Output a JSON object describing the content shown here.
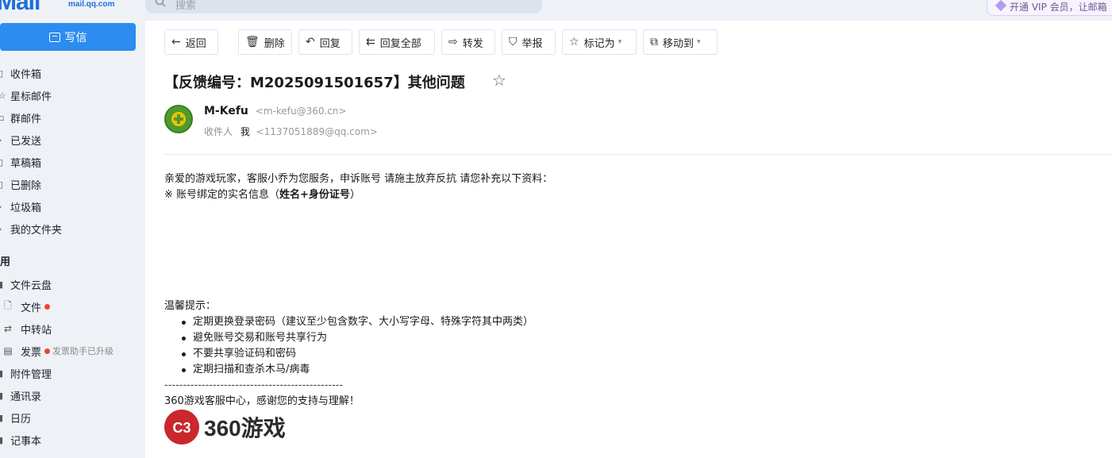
{
  "app": {
    "logo_text": "Mail",
    "logo_sub": "mail.qq.com",
    "search_placeholder": "搜索",
    "vip_text": "开通 VIP 会员，让邮箱"
  },
  "sidebar": {
    "compose_label": "写信",
    "items": [
      {
        "label": "收件箱",
        "icon": "inbox-icon"
      },
      {
        "label": "星标邮件",
        "icon": "star-icon"
      },
      {
        "label": "群邮件",
        "icon": "group-mail-icon"
      },
      {
        "label": "已发送",
        "icon": "sent-icon"
      },
      {
        "label": "草稿箱",
        "icon": "draft-icon"
      },
      {
        "label": "已删除",
        "icon": "trash-icon"
      },
      {
        "label": "垃圾箱",
        "icon": "spam-icon"
      },
      {
        "label": "我的文件夹",
        "icon": "folder-icon"
      }
    ],
    "section_label": "用",
    "apps": [
      {
        "label": "文件云盘",
        "icon": "cloud-icon"
      },
      {
        "label": "文件",
        "icon": "file-icon",
        "dot": true
      },
      {
        "label": "中转站",
        "icon": "transfer-icon"
      },
      {
        "label": "发票",
        "icon": "invoice-icon",
        "dot": true,
        "note": "发票助手已升级"
      },
      {
        "label": "附件管理",
        "icon": "attachment-icon"
      },
      {
        "label": "通讯录",
        "icon": "contacts-icon"
      },
      {
        "label": "日历",
        "icon": "calendar-icon"
      },
      {
        "label": "记事本",
        "icon": "notebook-icon"
      }
    ]
  },
  "toolbar": {
    "back": "返回",
    "delete": "删除",
    "reply": "回复",
    "reply_all": "回复全部",
    "forward": "转发",
    "report": "举报",
    "mark_as": "标记为",
    "move_to": "移动到"
  },
  "email": {
    "subject": "【反馈编号：M2025091501657】其他问题",
    "sender_name": "M-Kefu",
    "sender_addr": "<m-kefu@360.cn>",
    "recipient_label": "收件人",
    "recipient_name": "我",
    "recipient_addr": "<1137051889@qq.com>",
    "line1": "亲爱的游戏玩家，客服小乔为您服务，申诉账号 请施主放弃反抗 请您补充以下资料：",
    "line2_prefix": "※ 账号绑定的实名信息（",
    "line2_bold": "姓名+身份证号",
    "line2_suffix": "）",
    "tips_title": "温馨提示：",
    "tips": [
      "定期更换登录密码（建议至少包含数字、大小写字母、特殊字符其中两类）",
      "避免账号交易和账号共享行为",
      "不要共享验证码和密码",
      "定期扫描和查杀木马/病毒"
    ],
    "separator": "------------------------------------------------",
    "closing": "360游戏客服中心，感谢您的支持与理解！",
    "brand_logo_text": "C3",
    "brand_text": "360游戏"
  },
  "colors": {
    "accent": "#2d8cf0",
    "sidebar_bg": "#eef2f7",
    "dot": "#f04134",
    "brand_red": "#c9282d"
  }
}
